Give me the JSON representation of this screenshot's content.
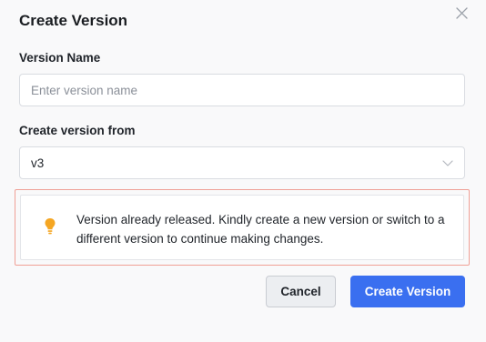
{
  "dialog": {
    "title": "Create Version",
    "close_icon": "close-icon"
  },
  "version_name": {
    "label": "Version Name",
    "value": "",
    "placeholder": "Enter version name"
  },
  "create_from": {
    "label": "Create version from",
    "selected": "v3",
    "chevron_icon": "chevron-down-icon"
  },
  "alert": {
    "icon": "lightbulb-icon",
    "icon_color": "#f5a623",
    "message": "Version already released. Kindly create a new version or switch to a different version to continue making changes."
  },
  "footer": {
    "cancel_label": "Cancel",
    "create_label": "Create Version",
    "primary_color": "#3a6ff0"
  }
}
